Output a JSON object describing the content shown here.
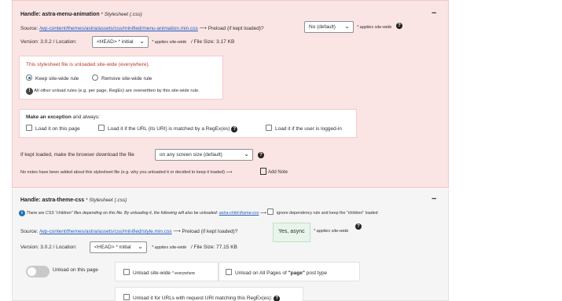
{
  "asset1": {
    "handle_label": "Handle:",
    "handle_name": "astra-menu-animation",
    "type": "* Stylesheet (.css)",
    "collapse": "−",
    "source_label": "Source:",
    "source_path": "/wp-content/themes/astra/assets/css/minified/menu-animation.min.css",
    "arrow": "⟶",
    "preload_label": "Preload (if kept loaded)?",
    "preload_value": "No (default)",
    "applies_sitewide": "* applies site-wide",
    "version_text": "Version: 3.0.2 / Location:",
    "location_value": "<HEAD> * initial",
    "applies_sitewide_2": "* applies site-wide",
    "filesize_text": "/ File Size: 3.17 KB",
    "unload_panel": {
      "notice": "This stylesheet file is unloaded site-wide (everywhere).",
      "radio_keep": "Keep site-wide rule",
      "radio_remove": "Remove site-wide rule",
      "warning": "All other unload rules (e.g. per page, RegEx) are overwritten by this site-wide rule."
    },
    "exception_panel": {
      "title": "Make an exception",
      "title_suffix": " and always:",
      "opt1": "Load it on this page",
      "opt2": "Load it if the URL (its URI) is matched by a RegEx(es)",
      "opt3": "Load it if the user is logged-in"
    },
    "kept_loaded_text": "If kept loaded, make the browser download the file",
    "screen_size_value": "on any screen size (default)",
    "no_notes": "No notes have been added about this stylesheet file (e.g. why you unloaded it or decided to keep it loaded) ⟶",
    "add_note": "Add Note"
  },
  "asset2": {
    "handle_label": "Handle:",
    "handle_name": "astra-theme-css",
    "type": "* Stylesheet (.css)",
    "collapse": "−",
    "children_notice": "There are CSS \"children\" files depending on this file. By unloading it, the following will also be unloaded:",
    "children_link": "astra-child-theme-css",
    "ignore_dependency": "ignore dependency rule and keep the \"children\" loaded",
    "source_label": "Source:",
    "source_path": "/wp-content/themes/astra/assets/css/minified/style.min.css",
    "arrow": "⟶",
    "preload_label": "Preload (if kept loaded)?",
    "preload_value": "Yes, async",
    "applies_sitewide": "* applies site-wide",
    "version_text": "Version: 3.0.2 / Location:",
    "location_value": "<HEAD> * initial",
    "applies_sitewide_2": "* applies site-wide",
    "filesize_text": "/ File Size: 77.15 KB",
    "unload_on_page": "Unload on this page",
    "unload_sitewide": "Unload site-wide",
    "everywhere": "* everywhere",
    "unload_all_pages_pre": "Unload on All Pages of ",
    "unload_all_pages_type": "\"page\"",
    "unload_all_pages_post": " post type",
    "unload_regex": "Unload it for URLs with request URI matching this RegEx(es):"
  },
  "icons": {
    "help": "?",
    "info": "i",
    "warning": "!",
    "chevron": "⌄",
    "note": "note-edit-icon"
  },
  "colors": {
    "unloaded_bg": "#fbe4e4",
    "loaded_bg": "#f5f5f5",
    "link": "#1f5cbf",
    "notice_red": "#c0392b",
    "preload_yes_bg": "#e8f5ea"
  }
}
